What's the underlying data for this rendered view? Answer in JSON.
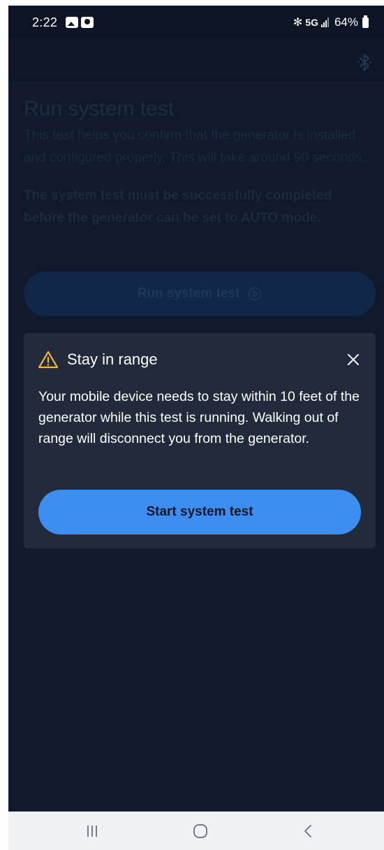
{
  "status_bar": {
    "time": "2:22",
    "network": "5G",
    "battery": "64%",
    "icons": [
      "gallery-notification-icon",
      "avatar-notification-icon",
      "bluetooth-icon",
      "signal-icon",
      "battery-icon"
    ]
  },
  "app_bar": {
    "icon": "bluetooth-icon"
  },
  "page": {
    "title": "Run system test",
    "description": "This test helps you confirm that the generator is installed and configured properly. This will take around 90 seconds.",
    "warning": "The system test must be successfully completed before the generator can be set to AUTO mode.",
    "run_button_label": "Run system test",
    "run_button_icon": "play-circle-icon"
  },
  "modal": {
    "title": "Stay in range",
    "title_icon": "warning-icon",
    "body": "Your mobile device needs to stay within 10 feet of the generator while this test is running. Walking out of range will disconnect you from the generator.",
    "start_button_label": "Start system test",
    "close_icon": "close-icon"
  },
  "nav_bar": {
    "items": [
      "recents-icon",
      "home-icon",
      "back-icon"
    ]
  },
  "colors": {
    "background": "#101a2c",
    "modal_background": "#212b3b",
    "primary_button": "#3c8ef0",
    "warning_icon": "#f5b93a",
    "nav_bar": "#f0f1f5"
  }
}
